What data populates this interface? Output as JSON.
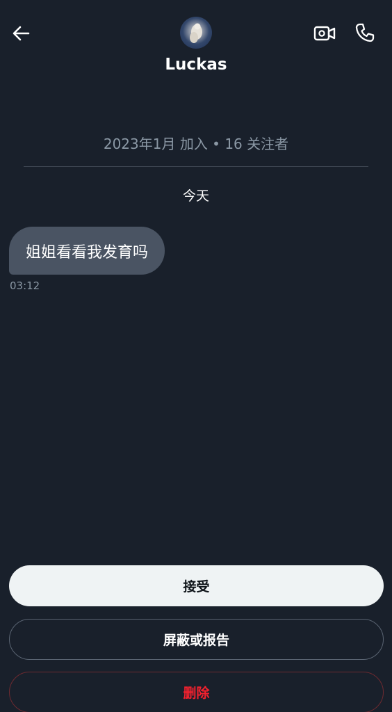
{
  "header": {
    "name": "Luckas",
    "back_icon": "arrow-left-icon",
    "video_icon": "video-camera-icon",
    "call_icon": "phone-icon"
  },
  "profile": {
    "joined_text": "2023年1月 加入 • 16 关注者"
  },
  "conversation": {
    "date_separator": "今天",
    "messages": [
      {
        "text": "姐姐看看我发育吗",
        "time": "03:12",
        "direction": "incoming"
      }
    ]
  },
  "actions": {
    "accept_label": "接受",
    "block_report_label": "屏蔽或报告",
    "delete_label": "删除"
  },
  "colors": {
    "background": "#19202b",
    "bubble": "#4a5463",
    "danger": "#f4212e",
    "accept_bg": "#eff3f4"
  }
}
